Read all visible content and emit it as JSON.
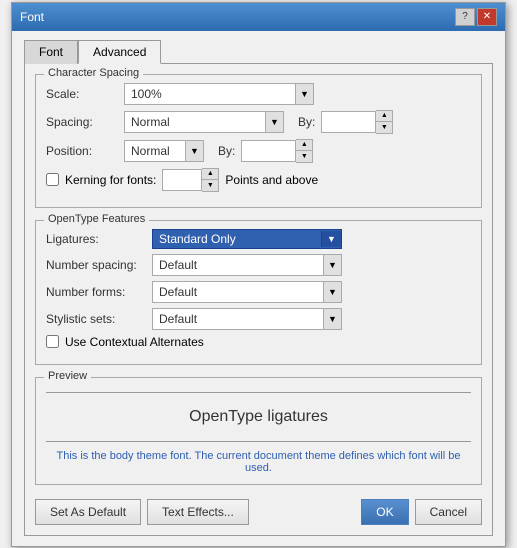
{
  "dialog": {
    "title": "Font",
    "tabs": [
      {
        "id": "font",
        "label": "Font",
        "active": false
      },
      {
        "id": "advanced",
        "label": "Advanced",
        "active": true
      }
    ]
  },
  "character_spacing": {
    "group_title": "Character Spacing",
    "scale_label": "Scale:",
    "scale_value": "100%",
    "spacing_label": "Spacing:",
    "spacing_value": "Normal",
    "position_label": "Position:",
    "position_value": "Normal",
    "by_label": "By:",
    "by_label2": "By:",
    "kerning_label": "Kerning for fonts:",
    "kerning_value": "",
    "points_label": "Points and above"
  },
  "opentype": {
    "group_title": "OpenType Features",
    "ligatures_label": "Ligatures:",
    "ligatures_value": "Standard Only",
    "number_spacing_label": "Number spacing:",
    "number_spacing_value": "Default",
    "number_forms_label": "Number forms:",
    "number_forms_value": "Default",
    "stylistic_label": "Stylistic sets:",
    "stylistic_value": "Default",
    "contextual_label": "Use Contextual Alternates"
  },
  "preview": {
    "title": "Preview",
    "text": "OpenType ligatures",
    "note": "This is the body theme font. The current document theme defines which font will be used."
  },
  "buttons": {
    "set_as_default": "Set As Default",
    "text_effects": "Text Effects...",
    "ok": "OK",
    "cancel": "Cancel"
  },
  "icons": {
    "help": "?",
    "close": "✕",
    "spin_up": "▲",
    "spin_down": "▼",
    "dropdown": "▼"
  }
}
